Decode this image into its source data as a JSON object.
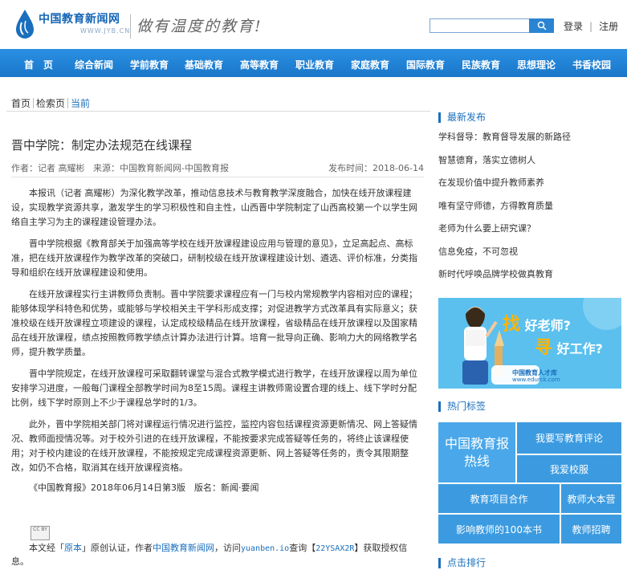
{
  "header": {
    "logo_name": "中国教育新闻网",
    "logo_url": "WWW.JYB.CN",
    "slogan": "做有温度的教育!",
    "search_placeholder": "",
    "login": "登录",
    "divider": "|",
    "register": "注册"
  },
  "nav": [
    "首　页",
    "综合新闻",
    "学前教育",
    "基础教育",
    "高等教育",
    "职业教育",
    "家庭教育",
    "国际教育",
    "民族教育",
    "思想理论",
    "书香校园"
  ],
  "breadcrumb": [
    "首页",
    "检索页",
    "当前"
  ],
  "article": {
    "title": "晋中学院：制定办法规范在线课程",
    "author": "作者：记者 高耀彬",
    "source": "来源：中国教育新闻网-中国教育报",
    "date": "发布时间：2018-06-14",
    "paragraphs": [
      "本报讯（记者 高耀彬）为深化教学改革，推动信息技术与教育教学深度融合，加快在线开放课程建设，实现教学资源共享，激发学生的学习积极性和自主性，山西晋中学院制定了山西高校第一个以学生网络自主学习为主的课程建设管理办法。",
      "晋中学院根据《教育部关于加强高等学校在线开放课程建设应用与管理的意见》，立足高起点、高标准，把在线开放课程作为教学改革的突破口，研制校级在线开放课程建设计划、遴选、评价标准，分类指导和组织在线开放课程建设和使用。",
      "在线开放课程实行主讲教师负责制。晋中学院要求课程应有一门与校内常规教学内容相对应的课程；能够体现学科特色和优势，或能够与学校相关主干学科形成支撑；对促进教学方式改革具有实际意义；获准校级在线开放课程立项建设的课程，认定成校级精品在线开放课程，省级精品在线开放课程以及国家精品在线开放课程，绩点按照教师教学绩点计算办法进行计算。培育一批导向正确、影响力大的网络教学名师，提升教学质量。",
      "晋中学院规定，在线开放课程可采取翻转课堂与混合式教学模式进行教学，在线开放课程以周为单位安排学习进度，一般每门课程全部教学时间为8至15周。课程主讲教师需设置合理的线上、线下学时分配比例，线下学时原则上不少于课程总学时的1/3。",
      "此外，晋中学院相关部门将对课程运行情况进行监控，监控内容包括课程资源更新情况、网上答疑情况、教师面授情况等。对于校外引进的在线开放课程，不能按要求完成答疑等任务的，将终止该课程使用；对于校内建设的在线开放课程，不能按规定完成课程资源更新、网上答疑等任务的，责令其限期整改，如仍不合格，取消其在线开放课程资格。"
    ],
    "citation": "《中国教育报》2018年06月14日第3版　版名：新闻·要闻",
    "cc_label": "CC\nBY",
    "license_pre": "本文经「",
    "license_orig": "原本",
    "license_mid": "」原创认证，作者",
    "license_author": "中国教育新闻网",
    "license_mid2": "，访问",
    "license_site": "yuanben.io",
    "license_mid3": "查询【",
    "license_code": "22YSAX2R",
    "license_post": "】获取授权信息。"
  },
  "sidebar": {
    "latest_title": "最新发布",
    "latest": [
      "学科督导：教育督导发展的新路径",
      "智慧德育，落实立德树人",
      "在发现价值中提升教师素养",
      "唯有坚守师德，方得教育质量",
      "老师为什么要上研究课？",
      "信息免疫，不可忽视",
      "新时代呼唤品牌学校做真教育"
    ],
    "banner": {
      "line1_big": "找",
      "line1": "好老师?",
      "line2_big": "寻",
      "line2": "好工作?",
      "brand": "中国教育人才库",
      "brand_url": "www.edurck.com"
    },
    "tags_title": "热门标签",
    "tags": [
      "中国教育报热线",
      "我要写教育评论",
      "我爱校服",
      "教育项目合作",
      "教师大本营",
      "影响教师的100本书",
      "教师招聘"
    ],
    "rank_title": "点击排行"
  },
  "colors": {
    "nav": "#1a76c9",
    "accent": "#1a6fbd",
    "banner": "#5bc0ee",
    "tag_blue": "#3c9be0"
  }
}
